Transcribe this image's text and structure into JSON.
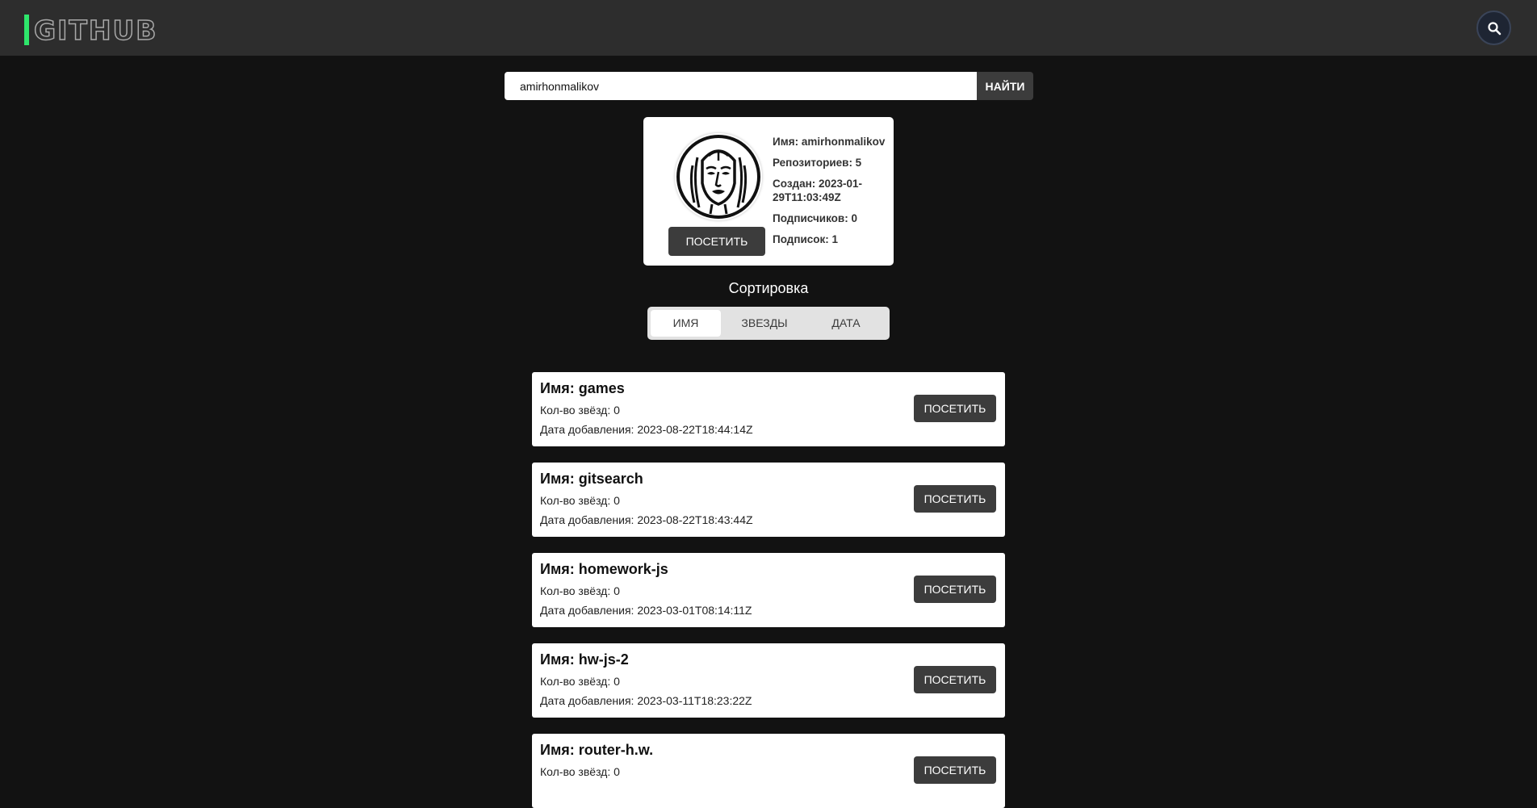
{
  "header": {
    "logo_text": "GITHUB",
    "search_icon": "search-icon"
  },
  "search": {
    "value": "amirhonmalikov",
    "button_label": "НАЙТИ"
  },
  "profile": {
    "name_line": "Имя: amirhonmalikov",
    "repos_line": "Репозиториев: 5",
    "created_line": "Создан: 2023-01-29T11:03:49Z",
    "followers_line": "Подписчиков: 0",
    "following_line": "Подписок: 1",
    "visit_label": "ПОСЕТИТЬ",
    "avatar_icon": "face-avatar-icon"
  },
  "sort": {
    "title": "Сортировка",
    "tabs": [
      {
        "label": "ИМЯ",
        "active": true
      },
      {
        "label": "ЗВЕЗДЫ",
        "active": false
      },
      {
        "label": "ДАТА",
        "active": false
      }
    ]
  },
  "repos": [
    {
      "name": "Имя: games",
      "stars": "Кол-во звёзд: 0",
      "date": "Дата добавления: 2023-08-22T18:44:14Z",
      "visit_label": "ПОСЕТИТЬ"
    },
    {
      "name": "Имя: gitsearch",
      "stars": "Кол-во звёзд: 0",
      "date": "Дата добавления: 2023-08-22T18:43:44Z",
      "visit_label": "ПОСЕТИТЬ"
    },
    {
      "name": "Имя: homework-js",
      "stars": "Кол-во звёзд: 0",
      "date": "Дата добавления: 2023-03-01T08:14:11Z",
      "visit_label": "ПОСЕТИТЬ"
    },
    {
      "name": "Имя: hw-js-2",
      "stars": "Кол-во звёзд: 0",
      "date": "Дата добавления: 2023-03-11T18:23:22Z",
      "visit_label": "ПОСЕТИТЬ"
    },
    {
      "name": "Имя: router-h.w.",
      "stars": "Кол-во звёзд: 0",
      "date": "",
      "visit_label": "ПОСЕТИТЬ"
    }
  ],
  "colors": {
    "background": "#121212",
    "header": "#2d2d2d",
    "accent": "#2ee66b",
    "button": "#3c3c3c"
  }
}
